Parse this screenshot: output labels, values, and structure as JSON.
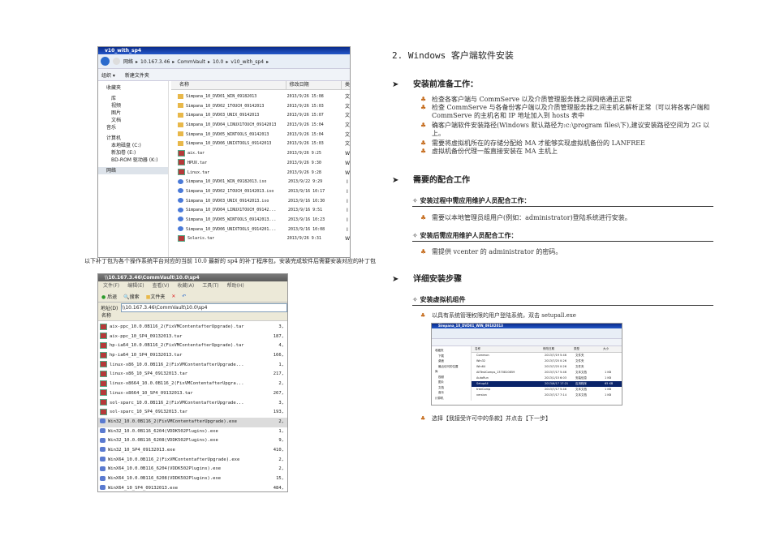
{
  "explorer1": {
    "title": "v10_with_sp4",
    "breadcrumb": [
      "网络",
      "10.167.3.46",
      "CommVault",
      "10.0",
      "v10_with_sp4"
    ],
    "toolbar": [
      "组织 ▾",
      "新建文件夹"
    ],
    "nav": [
      "收藏夹",
      "库",
      "视频",
      "图片",
      "文档",
      "音乐",
      "计算机",
      "本地磁盘 (C:)",
      "新加卷 (E:)",
      "BD-ROM 驱动器 (K:)",
      "网络"
    ],
    "columns": [
      "名称",
      "修改日期",
      "类"
    ],
    "files": [
      {
        "name": "Simpana_10_DVD01_WIN_09182013",
        "date": "2013/9/26 15:08",
        "type": "文",
        "icon": "folder"
      },
      {
        "name": "Simpana_10_DVD02_1TOUCH_09142013",
        "date": "2013/9/26 15:03",
        "type": "文",
        "icon": "folder"
      },
      {
        "name": "Simpana_10_DVD03_UNIX_09142013",
        "date": "2013/9/26 15:07",
        "type": "文",
        "icon": "folder"
      },
      {
        "name": "Simpana_10_DVD04_LINUX1TOUCH_09142013",
        "date": "2013/9/26 15:04",
        "type": "文",
        "icon": "folder"
      },
      {
        "name": "Simpana_10_DVD05_WINTOOLS_09142013",
        "date": "2013/9/26 15:04",
        "type": "文",
        "icon": "folder"
      },
      {
        "name": "Simpana_10_DVD06_UNIXTOOLS_09142013",
        "date": "2013/9/26 15:03",
        "type": "文",
        "icon": "folder"
      },
      {
        "name": "aix.tar",
        "date": "2013/9/26 9:25",
        "type": "W",
        "icon": "rar"
      },
      {
        "name": "HPUX.tar",
        "date": "2013/9/26 9:30",
        "type": "W",
        "icon": "rar"
      },
      {
        "name": "Linux.tar",
        "date": "2013/9/26 9:28",
        "type": "W",
        "icon": "rar"
      },
      {
        "name": "Simpana_10_DVD01_WIN_09182013.iso",
        "date": "2013/9/22 9:29",
        "type": "I",
        "icon": "iso"
      },
      {
        "name": "Simpana_10_DVD02_1TOUCH_09142013.iso",
        "date": "2013/9/16 10:17",
        "type": "I",
        "icon": "iso"
      },
      {
        "name": "Simpana_10_DVD03_UNIX_09142013.iso",
        "date": "2013/9/16 10:30",
        "type": "I",
        "icon": "iso"
      },
      {
        "name": "Simpana_10_DVD04_LINUX1TOUCH_09142...",
        "date": "2013/9/16 9:51",
        "type": "I",
        "icon": "iso"
      },
      {
        "name": "Simpana_10_DVD05_WINTOOLS_09142013...",
        "date": "2013/9/16 10:23",
        "type": "I",
        "icon": "iso"
      },
      {
        "name": "Simpana_10_DVD06_UNIXTOOLS_0914201...",
        "date": "2013/9/16 10:08",
        "type": "I",
        "icon": "iso"
      },
      {
        "name": "Solaris.tar",
        "date": "2013/9/26 9:31",
        "type": "W",
        "icon": "rar"
      }
    ]
  },
  "caption": "以下补丁包为各个操作系统平台对应的当前 10.0 最新的 sp4 的补丁程序包，安装完成软件后需要安装对应的补丁包",
  "explorer2": {
    "title": "\\\\10.167.3.46\\CommVault\\10.0\\sp4",
    "menu": [
      "文件(F)",
      "编辑(E)",
      "查看(V)",
      "收藏(A)",
      "工具(T)",
      "帮助(H)"
    ],
    "toolbar": [
      "后退",
      "搜索",
      "文件夹"
    ],
    "address_label": "地址(D)",
    "address": "\\\\10.167.3.46\\CommVault\\10.0\\sp4",
    "column": "名称",
    "files": [
      {
        "name": "aix-ppc_10.0.0B116_2(FixVMContentafterUpgrade).tar",
        "size": "3,",
        "icon": "rar"
      },
      {
        "name": "aix-ppc_10_SP4_09132013.tar",
        "size": "187,",
        "icon": "rar"
      },
      {
        "name": "hp-ia64_10.0.0B116_2(FixVMContentafterUpgrade).tar",
        "size": "4,",
        "icon": "rar"
      },
      {
        "name": "hp-ia64_10_SP4_09132013.tar",
        "size": "166,",
        "icon": "rar"
      },
      {
        "name": "linux-x86_10.0.0B116_2(FixVMContentafterUpgrade...",
        "size": "1,",
        "icon": "rar"
      },
      {
        "name": "linux-x86_10_SP4_09132013.tar",
        "size": "217,",
        "icon": "rar"
      },
      {
        "name": "linux-x8664_10.0.0B116_2(FixVMContentafterUpgra...",
        "size": "2,",
        "icon": "rar"
      },
      {
        "name": "linux-x8664_10_SP4_09132013.tar",
        "size": "267,",
        "icon": "rar"
      },
      {
        "name": "sol-sparc_10.0.0B116_2(FixVMContentafterUpgrade...",
        "size": "3,",
        "icon": "rar"
      },
      {
        "name": "sol-sparc_10_SP4_09132013.tar",
        "size": "193,",
        "icon": "rar"
      },
      {
        "name": "Win32_10.0.0B116_2(FixVMContentafterUpgrade).exe",
        "size": "2,",
        "icon": "exe"
      },
      {
        "name": "Win32_10.0.0B116_6204(VDDK502Plugins).exe",
        "size": "1,",
        "icon": "exe"
      },
      {
        "name": "Win32_10.0.0B116_6208(VDDK502Plugins).exe",
        "size": "9,",
        "icon": "exe"
      },
      {
        "name": "Win32_10_SP4_09132013.exe",
        "size": "410,",
        "icon": "exe"
      },
      {
        "name": "WinX64_10.0.0B116_2(FixVMContentafterUpgrade).exe",
        "size": "2,",
        "icon": "exe"
      },
      {
        "name": "WinX64_10.0.0B116_6204(VDDK502Plugins).exe",
        "size": "2,",
        "icon": "exe"
      },
      {
        "name": "WinX64_10.0.0B116_6208(VDDK502Plugins).exe",
        "size": "15,",
        "icon": "exe"
      },
      {
        "name": "WinX64_10_SP4_09132013.exe",
        "size": "484,",
        "icon": "exe"
      }
    ]
  },
  "doc": {
    "heading": "2. Windows 客户端软件安装",
    "sec1": "安装前准备工作：",
    "sec1_items": [
      "检查各客户端与 CommServe 以及介质管理服务器之间网络通迅正常",
      "检查 CommServe 与各备份客户端以及介质管理服务器之间主机名解析正常（可以将各客户端和 CommServe 的主机名和 IP 地址加入到 hosts 表中",
      "确客户端软件安装路径(Windows 默认路径为:c:\\program files\\下),建议安装路径空间为 2G 以上。",
      "需要将虚拟机所在的存储分配给 MA 才能够实现虚拟机备份的 LANFREE",
      "虚拟机备份代理一般直接安装在 MA 主机上"
    ],
    "sec2": "需要的配合工作",
    "sub1": "安装过程中需应用维护人员配合工作：",
    "sub1_item": "需要以本地管理员组用户(例如：administrator)登陆系统进行安装。",
    "sub2": "安装后需应用维护人员配合工作：",
    "sub2_item": "需提供 vcenter 的 administrator 的密码。",
    "sec3": "详细安装步骤",
    "sub3": "安装虚拟机组件",
    "sub3_item1": "以具有系统管理权限的用户登陆系统，双击 setupall.exe",
    "sub3_item2": "选择【我接受许可中的条款】并点击【下一步】"
  },
  "explorer3": {
    "title": "Simpana_10_DVD01_WIN_09182013",
    "columns": [
      "名称",
      "修改日期",
      "类型",
      "大小"
    ],
    "nav": [
      "收藏夹",
      "下载",
      "桌面",
      "最近访问的位置",
      "库",
      "视频",
      "图片",
      "文档",
      "音乐",
      "计算机"
    ],
    "files": [
      {
        "name": "Common",
        "date": "2013/7/19 5:46",
        "type": "文件夹",
        "size": ""
      },
      {
        "name": "Win32",
        "date": "2013/7/25 0:26",
        "type": "文件夹",
        "size": ""
      },
      {
        "name": "Win64",
        "date": "2013/7/25 0:26",
        "type": "文件夹",
        "size": ""
      },
      {
        "name": "AllTestComps_1370810859",
        "date": "2013/7/17 5:46",
        "type": "文本文档",
        "size": "1 KB"
      },
      {
        "name": "AutoRun",
        "date": "2013/1/15 6:03",
        "type": "安装信息",
        "size": "1 KB"
      },
      {
        "name": "SetupAll",
        "date": "2013/6/17 17:21",
        "type": "应用程序",
        "size": "65 KB"
      },
      {
        "name": "treeComp",
        "date": "2013/7/17 5:46",
        "type": "文本文档",
        "size": "1 KB"
      },
      {
        "name": "version",
        "date": "2013/7/17 7:14",
        "type": "文本文档",
        "size": "1 KB"
      }
    ]
  }
}
